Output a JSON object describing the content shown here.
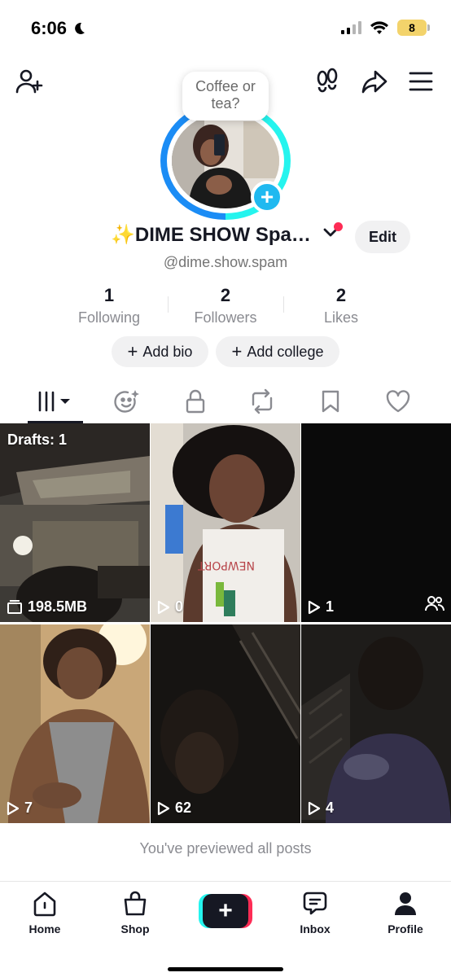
{
  "status_bar": {
    "time": "6:06",
    "battery_level": "8",
    "icons": [
      "moon-icon",
      "cellular-signal-icon",
      "wifi-icon",
      "battery-icon"
    ]
  },
  "header": {
    "icons": [
      "add-friend-icon",
      "footprints-icon",
      "share-icon",
      "menu-icon"
    ]
  },
  "profile": {
    "bubble_text_line1": "Coffee or",
    "bubble_text_line2": "tea?",
    "display_name": "✨DIME SHOW Spa…",
    "username": "@dime.show.spam",
    "edit_label": "Edit"
  },
  "stats": [
    {
      "value": "1",
      "label": "Following"
    },
    {
      "value": "2",
      "label": "Followers"
    },
    {
      "value": "2",
      "label": "Likes"
    }
  ],
  "actions": {
    "add_bio": "Add bio",
    "add_college": "Add college"
  },
  "tabs": [
    {
      "icon": "videos-grid-icon",
      "active": true
    },
    {
      "icon": "reposts-face-icon"
    },
    {
      "icon": "lock-icon"
    },
    {
      "icon": "repost-icon"
    },
    {
      "icon": "bookmark-icon"
    },
    {
      "icon": "heart-icon"
    }
  ],
  "grid": {
    "drafts_label": "Drafts: 1",
    "items": [
      {
        "type": "drafts",
        "label": "198.5MB",
        "icon": "drafts-folder-icon"
      },
      {
        "type": "video",
        "views": "0",
        "icon": "play-icon"
      },
      {
        "type": "video",
        "views": "1",
        "icon": "play-icon",
        "extra_icon": "collab-icon"
      },
      {
        "type": "video",
        "views": "7",
        "icon": "play-icon"
      },
      {
        "type": "video",
        "views": "62",
        "icon": "play-icon"
      },
      {
        "type": "video",
        "views": "4",
        "icon": "play-icon"
      }
    ]
  },
  "preview_note": "You've previewed all posts",
  "bottom_nav": [
    {
      "label": "Home",
      "icon": "home-icon"
    },
    {
      "label": "Shop",
      "icon": "shopping-bag-icon"
    },
    {
      "label": "",
      "icon": "create-plus-icon"
    },
    {
      "label": "Inbox",
      "icon": "inbox-icon"
    },
    {
      "label": "Profile",
      "icon": "profile-icon"
    }
  ],
  "colors": {
    "accent_pink": "#fe2c55",
    "accent_cyan": "#25f4ee",
    "plus_badge": "#20b9f0",
    "battery": "#f3d36b"
  }
}
